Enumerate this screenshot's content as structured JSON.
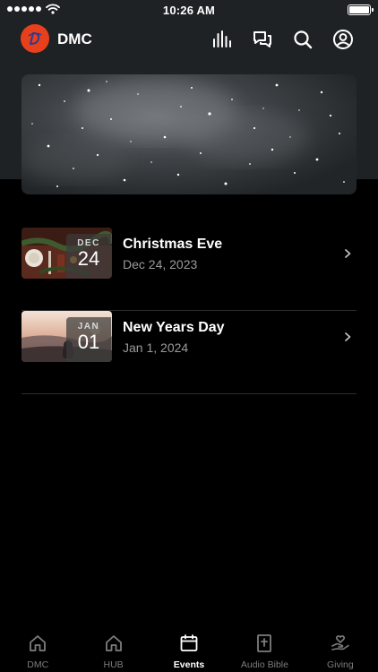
{
  "status_bar": {
    "time": "10:26 AM"
  },
  "header": {
    "brand": "DMC"
  },
  "events": [
    {
      "title": "Christmas Eve",
      "date": "Dec 24, 2023",
      "month": "DEC",
      "day": "24"
    },
    {
      "title": "New Years Day",
      "date": "Jan 1, 2024",
      "month": "JAN",
      "day": "01"
    }
  ],
  "tabs": [
    {
      "label": "DMC",
      "icon": "home-icon",
      "active": false
    },
    {
      "label": "HUB",
      "icon": "home-icon",
      "active": false
    },
    {
      "label": "Events",
      "icon": "calendar-icon",
      "active": true
    },
    {
      "label": "Audio Bible",
      "icon": "bible-icon",
      "active": false
    },
    {
      "label": "Giving",
      "icon": "giving-heart-hand-icon",
      "active": false
    }
  ],
  "colors": {
    "brand": "#e8401c",
    "background": "#000000",
    "header_bg": "#1f2224",
    "muted_text": "#9a9a9a"
  }
}
